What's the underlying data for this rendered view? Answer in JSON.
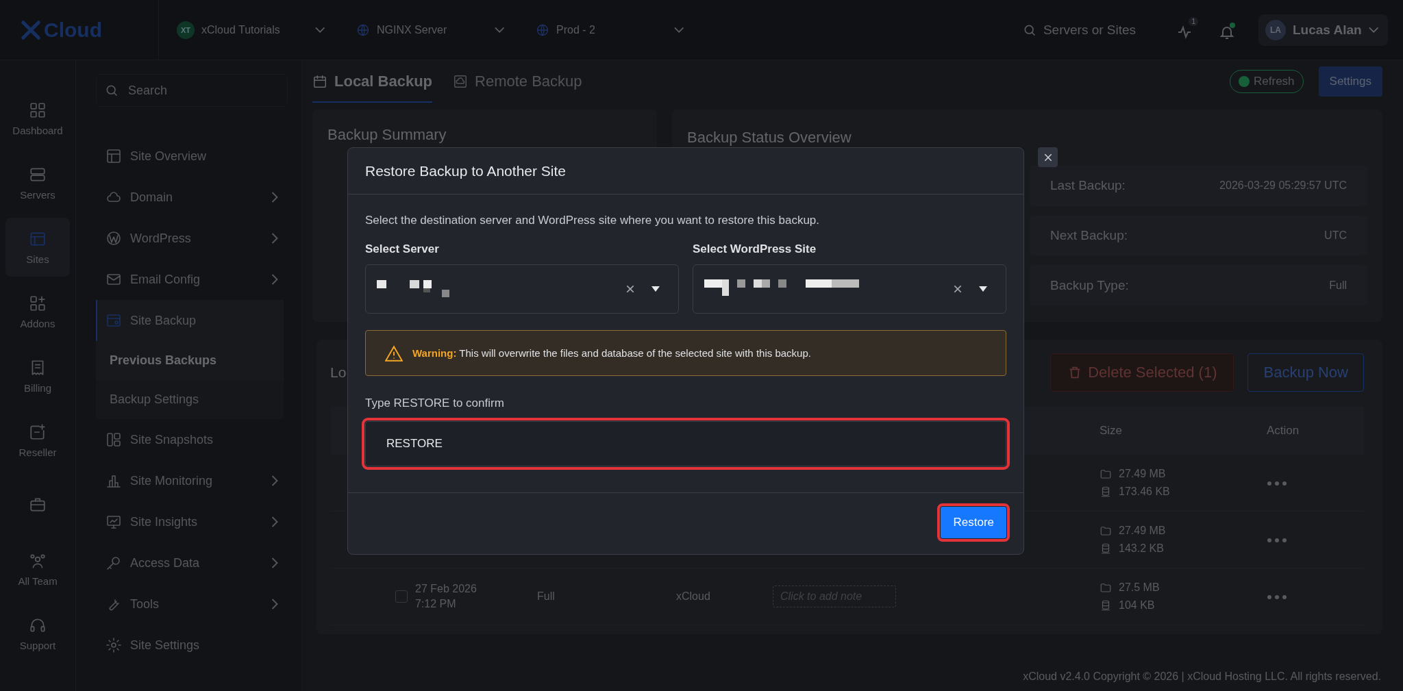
{
  "topbar": {
    "logo": "Cloud",
    "selectors": [
      {
        "kind": "team",
        "avatar": "XT",
        "label": "xCloud Tutorials"
      },
      {
        "kind": "server",
        "label": "NGINX Server"
      },
      {
        "kind": "site",
        "label": "Prod - 2"
      }
    ],
    "search": {
      "placeholder": "Servers or Sites"
    },
    "activity_badge": "1",
    "notifications_unread": true,
    "user": {
      "initials": "LA",
      "name": "Lucas Alan"
    }
  },
  "rail": [
    {
      "kind": "dashboard",
      "label": "Dashboard",
      "selected": false
    },
    {
      "kind": "servers",
      "label": "Servers",
      "selected": false
    },
    {
      "kind": "sites",
      "label": "Sites",
      "selected": true
    },
    {
      "kind": "addons",
      "label": "Addons",
      "selected": false
    },
    {
      "kind": "billing",
      "label": "Billing",
      "selected": false
    },
    {
      "kind": "reseller",
      "label": "Reseller",
      "selected": false
    },
    {
      "kind": "enterprise",
      "selected": false
    },
    {
      "kind": "team",
      "label": "All Team",
      "selected": false
    },
    {
      "kind": "support",
      "label": "Support",
      "selected": false
    }
  ],
  "site_menu": {
    "search": {
      "placeholder": "Search"
    },
    "items": [
      {
        "kind": "overview",
        "label": "Site Overview",
        "has_submenu": false,
        "selected": false
      },
      {
        "kind": "domain",
        "label": "Domain",
        "has_submenu": true,
        "selected": false
      },
      {
        "kind": "wordpress",
        "label": "WordPress",
        "has_submenu": true,
        "selected": false
      },
      {
        "kind": "email",
        "label": "Email Config",
        "has_submenu": true,
        "selected": false
      },
      {
        "kind": "backup",
        "label": "Site Backup",
        "has_submenu": false,
        "selected": true,
        "expanded": true,
        "children": [
          {
            "label": "Previous Backups",
            "selected": true
          },
          {
            "label": "Backup Settings",
            "selected": false
          }
        ]
      },
      {
        "kind": "snapshots",
        "label": "Site Snapshots",
        "has_submenu": false,
        "selected": false
      },
      {
        "kind": "monitoring",
        "label": "Site Monitoring",
        "has_submenu": true,
        "selected": false
      },
      {
        "kind": "insights",
        "label": "Site Insights",
        "has_submenu": true,
        "selected": false
      },
      {
        "kind": "access",
        "label": "Access Data",
        "has_submenu": true,
        "selected": false
      },
      {
        "kind": "tools",
        "label": "Tools",
        "has_submenu": true,
        "selected": false
      },
      {
        "kind": "settings",
        "label": "Site Settings",
        "has_submenu": false,
        "selected": false
      }
    ]
  },
  "tabs": [
    {
      "kind": "local",
      "label": "Local Backup",
      "selected": true
    },
    {
      "kind": "remote",
      "label": "Remote Backup",
      "selected": false
    }
  ],
  "refresh_button": "Refresh",
  "settings_button": "Settings",
  "summary_card": {
    "title": "Backup Summary"
  },
  "status_card": {
    "title": "Backup Status Overview",
    "rows": [
      {
        "label": "Last Backup:",
        "value": "2026-03-29 05:29:57 UTC"
      },
      {
        "label": "Next Backup:",
        "value": "UTC"
      },
      {
        "label": "Backup Type:",
        "value": "Full"
      }
    ]
  },
  "backups": {
    "title": "Lo",
    "delete_button": "Delete Selected (1)",
    "backup_button": "Backup Now",
    "columns": [
      "Size",
      "Action"
    ],
    "rows": [
      {
        "files_size": "27.49 MB",
        "db_size": "173.46 KB"
      },
      {
        "files_size": "27.49 MB",
        "db_size": "143.2 KB"
      },
      {
        "checked": false,
        "date": "27 Feb 2026",
        "time": "7:12 PM",
        "type": "Full",
        "source": "xCloud",
        "note_placeholder": "Click to add note",
        "files_size": "27.5 MB",
        "db_size": "104 KB"
      }
    ]
  },
  "footer": "xCloud v2.4.0 Copyright © 2026 | xCloud Hosting LLC. All rights reserved.",
  "modal": {
    "title": "Restore Backup to Another Site",
    "description": "Select the destination server and WordPress site where you want to restore this backup.",
    "fields": [
      {
        "label": "Select Server"
      },
      {
        "label": "Select WordPress Site"
      }
    ],
    "warning": "**Warning:** This will overwrite the files and database of the selected site with this backup.",
    "confirm_label": "Type RESTORE to confirm",
    "confirm_value": "RESTORE",
    "confirm_highlighted": true,
    "submit": "Restore",
    "submit_highlighted": true
  }
}
